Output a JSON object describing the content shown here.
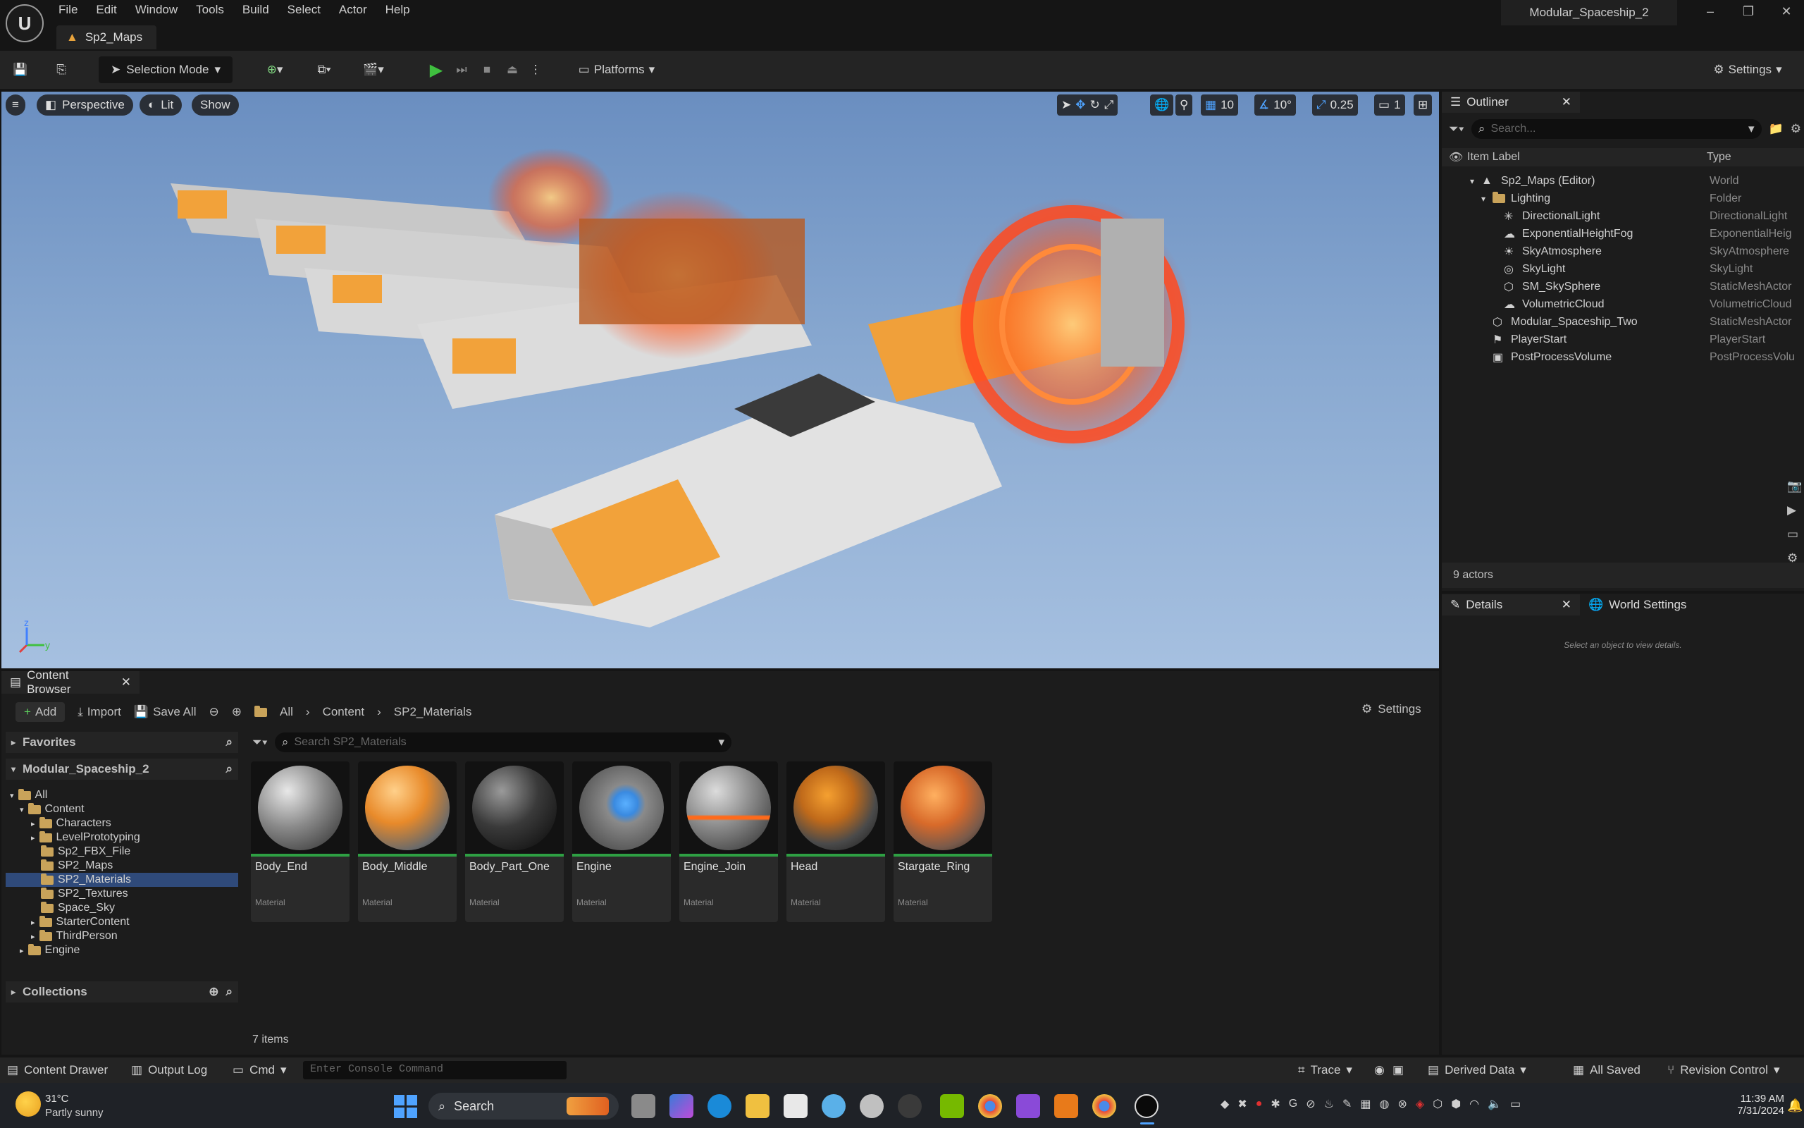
{
  "menu": [
    "File",
    "Edit",
    "Window",
    "Tools",
    "Build",
    "Select",
    "Actor",
    "Help"
  ],
  "window_title": "Modular_Spaceship_2",
  "map_tab": "Sp2_Maps",
  "toolbar": {
    "selection_mode": "Selection Mode",
    "platforms": "Platforms",
    "settings": "Settings"
  },
  "viewport": {
    "perspective": "Perspective",
    "lit": "Lit",
    "show": "Show",
    "grid_snap": "10",
    "rotation_snap": "10°",
    "scale_snap": "0.25",
    "camera_speed": "1"
  },
  "outliner": {
    "title": "Outliner",
    "search_placeholder": "Search...",
    "col_label": "Item Label",
    "col_type": "Type",
    "rows": [
      {
        "label": "Sp2_Maps (Editor)",
        "type": "World"
      },
      {
        "label": "Lighting",
        "type": "Folder"
      },
      {
        "label": "DirectionalLight",
        "type": "DirectionalLight"
      },
      {
        "label": "ExponentialHeightFog",
        "type": "ExponentialHeig"
      },
      {
        "label": "SkyAtmosphere",
        "type": "SkyAtmosphere"
      },
      {
        "label": "SkyLight",
        "type": "SkyLight"
      },
      {
        "label": "SM_SkySphere",
        "type": "StaticMeshActor"
      },
      {
        "label": "VolumetricCloud",
        "type": "VolumetricCloud"
      },
      {
        "label": "Modular_Spaceship_Two",
        "type": "StaticMeshActor"
      },
      {
        "label": "PlayerStart",
        "type": "PlayerStart"
      },
      {
        "label": "PostProcessVolume",
        "type": "PostProcessVolu"
      }
    ],
    "count": "9 actors"
  },
  "details": {
    "tab": "Details",
    "world_tab": "World Settings",
    "empty": "Select an object to view details."
  },
  "content_browser": {
    "title": "Content Browser",
    "add": "Add",
    "import": "Import",
    "save_all": "Save All",
    "breadcrumb": [
      "All",
      "Content",
      "SP2_Materials"
    ],
    "settings": "Settings",
    "favorites": "Favorites",
    "project": "Modular_Spaceship_2",
    "search_placeholder": "Search SP2_Materials",
    "tree": [
      "All",
      "Content",
      "Characters",
      "LevelPrototyping",
      "Sp2_FBX_File",
      "SP2_Maps",
      "SP2_Materials",
      "SP2_Textures",
      "Space_Sky",
      "StarterContent",
      "ThirdPerson",
      "Engine"
    ],
    "collections": "Collections",
    "items": [
      {
        "name": "Body_End",
        "type": "Material"
      },
      {
        "name": "Body_Middle",
        "type": "Material"
      },
      {
        "name": "Body_Part_One",
        "type": "Material"
      },
      {
        "name": "Engine",
        "type": "Material"
      },
      {
        "name": "Engine_Join",
        "type": "Material"
      },
      {
        "name": "Head",
        "type": "Material"
      },
      {
        "name": "Stargate_Ring",
        "type": "Material"
      }
    ],
    "item_count": "7 items"
  },
  "statusbar": {
    "content_drawer": "Content Drawer",
    "output_log": "Output Log",
    "cmd": "Cmd",
    "console_placeholder": "Enter Console Command",
    "trace": "Trace",
    "derived_data": "Derived Data",
    "all_saved": "All Saved",
    "revision_control": "Revision Control"
  },
  "taskbar": {
    "weather_temp": "31°C",
    "weather_desc": "Partly sunny",
    "search": "Search",
    "time": "11:39 AM",
    "date": "7/31/2024"
  },
  "colors": {
    "accent": "#4fa3ff",
    "play": "#3fbf3f",
    "selected": "#2f4a7a"
  }
}
